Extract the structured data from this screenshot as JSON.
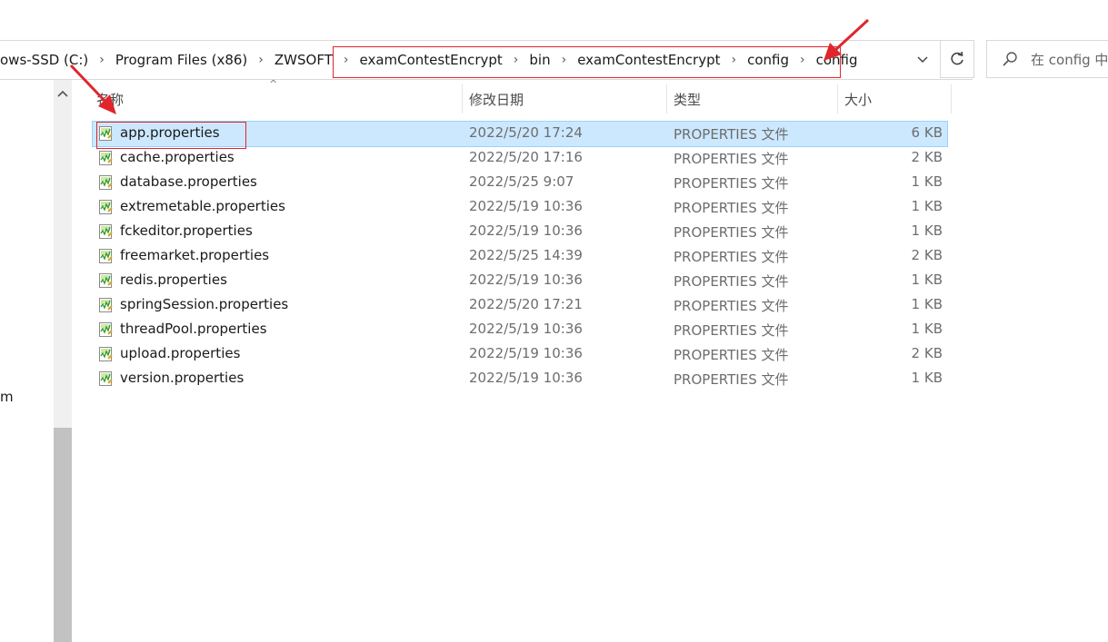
{
  "breadcrumb": {
    "items": [
      {
        "label": "ows-SSD (C:)"
      },
      {
        "label": "Program Files (x86)"
      },
      {
        "label": "ZWSOFT"
      },
      {
        "label": "examContestEncrypt"
      },
      {
        "label": "bin"
      },
      {
        "label": "examContestEncrypt"
      },
      {
        "label": "config"
      },
      {
        "label": "config"
      }
    ]
  },
  "search": {
    "placeholder": "在 config 中"
  },
  "nav": {
    "partial_text": "m"
  },
  "columns": {
    "name": "名称",
    "date": "修改日期",
    "type": "类型",
    "size": "大小"
  },
  "files": [
    {
      "name": "app.properties",
      "date": "2022/5/20 17:24",
      "type": "PROPERTIES 文件",
      "size": "6 KB",
      "selected": true
    },
    {
      "name": "cache.properties",
      "date": "2022/5/20 17:16",
      "type": "PROPERTIES 文件",
      "size": "2 KB"
    },
    {
      "name": "database.properties",
      "date": "2022/5/25 9:07",
      "type": "PROPERTIES 文件",
      "size": "1 KB"
    },
    {
      "name": "extremetable.properties",
      "date": "2022/5/19 10:36",
      "type": "PROPERTIES 文件",
      "size": "1 KB"
    },
    {
      "name": "fckeditor.properties",
      "date": "2022/5/19 10:36",
      "type": "PROPERTIES 文件",
      "size": "1 KB"
    },
    {
      "name": "freemarket.properties",
      "date": "2022/5/25 14:39",
      "type": "PROPERTIES 文件",
      "size": "2 KB"
    },
    {
      "name": "redis.properties",
      "date": "2022/5/19 10:36",
      "type": "PROPERTIES 文件",
      "size": "1 KB"
    },
    {
      "name": "springSession.properties",
      "date": "2022/5/20 17:21",
      "type": "PROPERTIES 文件",
      "size": "1 KB"
    },
    {
      "name": "threadPool.properties",
      "date": "2022/5/19 10:36",
      "type": "PROPERTIES 文件",
      "size": "1 KB"
    },
    {
      "name": "upload.properties",
      "date": "2022/5/19 10:36",
      "type": "PROPERTIES 文件",
      "size": "2 KB"
    },
    {
      "name": "version.properties",
      "date": "2022/5/19 10:36",
      "type": "PROPERTIES 文件",
      "size": "1 KB"
    }
  ],
  "colors": {
    "selection": "#cce8ff",
    "annotation": "#e0262c"
  }
}
